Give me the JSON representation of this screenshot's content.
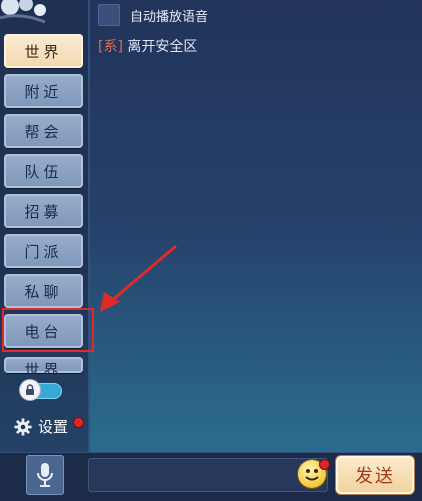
{
  "sidebar": {
    "tabs": [
      {
        "label": "世界",
        "active": true
      },
      {
        "label": "附近",
        "active": false
      },
      {
        "label": "帮会",
        "active": false
      },
      {
        "label": "队伍",
        "active": false
      },
      {
        "label": "招募",
        "active": false
      },
      {
        "label": "门派",
        "active": false
      },
      {
        "label": "私聊",
        "active": false
      },
      {
        "label": "电台",
        "active": false
      },
      {
        "label": "世界",
        "active": false
      }
    ],
    "settings_label": "设置",
    "toggle_on": true
  },
  "chat": {
    "auto_play_label": "自动播放语音",
    "messages": [
      {
        "tag": "[系]",
        "text": "离开安全区"
      }
    ]
  },
  "bottom": {
    "send_label": "发送"
  },
  "colors": {
    "active_tab": "#f3dbb4",
    "tab": "#8ea5c6",
    "highlight": "#e02a2a",
    "system_tag": "#e06a55",
    "toggle": "#37a9d6"
  },
  "icons": [
    "lock-icon",
    "gear-icon",
    "microphone-icon",
    "emoji-icon",
    "arrow-annotation"
  ]
}
